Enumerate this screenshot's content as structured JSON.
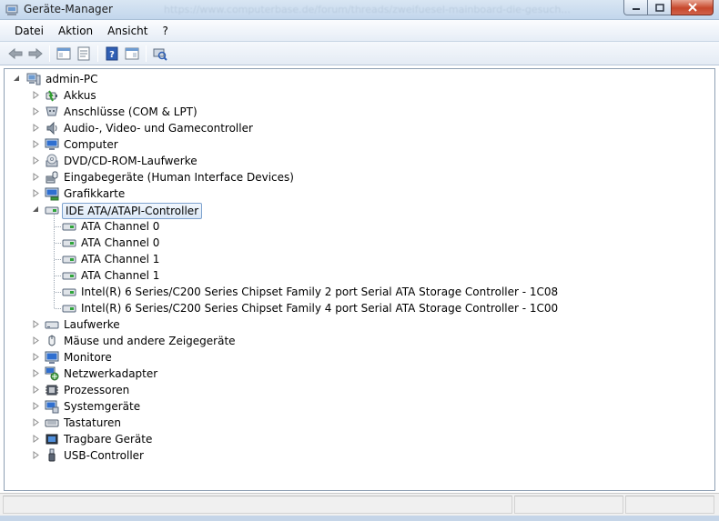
{
  "window": {
    "title": "Geräte-Manager",
    "background_url_text": "https://www.computerbase.de/forum/threads/zweifuesel-mainboard-die-gesuch..."
  },
  "menu": [
    "Datei",
    "Aktion",
    "Ansicht",
    "?"
  ],
  "toolbar": [
    {
      "name": "back-icon"
    },
    {
      "name": "forward-icon"
    },
    {
      "name": "show-hide-console-tree-icon"
    },
    {
      "name": "properties-icon"
    },
    {
      "name": "help-icon"
    },
    {
      "name": "show-action-pane-icon"
    },
    {
      "name": "scan-hardware-icon"
    }
  ],
  "tree": {
    "root": "admin-PC",
    "categories": [
      {
        "label": "Akkus",
        "icon": "battery-icon"
      },
      {
        "label": "Anschlüsse (COM & LPT)",
        "icon": "port-icon"
      },
      {
        "label": "Audio-, Video- und Gamecontroller",
        "icon": "speaker-icon"
      },
      {
        "label": "Computer",
        "icon": "computer-icon"
      },
      {
        "label": "DVD/CD-ROM-Laufwerke",
        "icon": "dvd-drive-icon"
      },
      {
        "label": "Eingabegeräte (Human Interface Devices)",
        "icon": "hid-icon"
      },
      {
        "label": "Grafikkarte",
        "icon": "display-adapter-icon"
      },
      {
        "label": "IDE ATA/ATAPI-Controller",
        "icon": "ide-controller-icon",
        "expanded": true,
        "selected": true,
        "children": [
          "ATA Channel 0",
          "ATA Channel 0",
          "ATA Channel 1",
          "ATA Channel 1",
          "Intel(R) 6 Series/C200 Series Chipset Family 2 port Serial ATA Storage Controller - 1C08",
          "Intel(R) 6 Series/C200 Series Chipset Family 4 port Serial ATA Storage Controller - 1C00"
        ]
      },
      {
        "label": "Laufwerke",
        "icon": "disk-drive-icon"
      },
      {
        "label": "Mäuse und andere Zeigegeräte",
        "icon": "mouse-icon"
      },
      {
        "label": "Monitore",
        "icon": "monitor-icon"
      },
      {
        "label": "Netzwerkadapter",
        "icon": "network-adapter-icon"
      },
      {
        "label": "Prozessoren",
        "icon": "processor-icon"
      },
      {
        "label": "Systemgeräte",
        "icon": "system-devices-icon"
      },
      {
        "label": "Tastaturen",
        "icon": "keyboard-icon"
      },
      {
        "label": "Tragbare Geräte",
        "icon": "portable-device-icon"
      },
      {
        "label": "USB-Controller",
        "icon": "usb-icon"
      }
    ]
  },
  "colors": {
    "selection_border": "#7da2ce",
    "selection_fill": "#dbe8f7",
    "close_button": "#c7482c"
  }
}
